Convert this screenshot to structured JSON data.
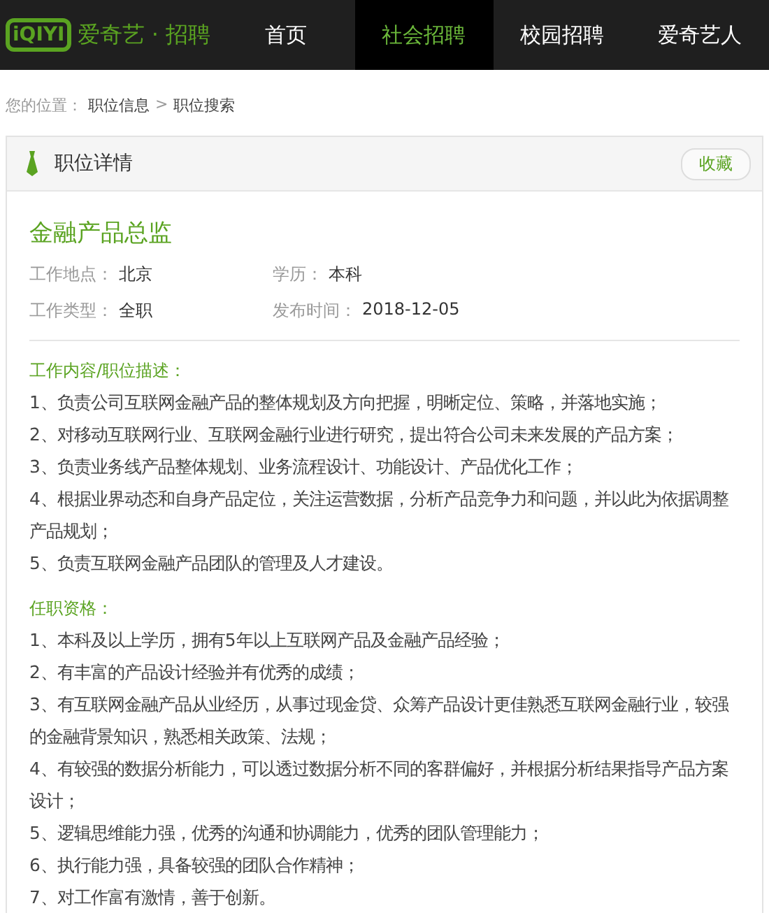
{
  "header": {
    "logo_mark": "iQIYI",
    "brand": "爱奇艺 · 招聘",
    "nav": [
      {
        "label": "首页",
        "selected": false
      },
      {
        "label": "社会招聘",
        "selected": true
      },
      {
        "label": "校园招聘",
        "selected": false
      },
      {
        "label": "爱奇艺人",
        "selected": false
      }
    ]
  },
  "breadcrumb": {
    "prefix": "您的位置：",
    "items": [
      "职位信息",
      "职位搜索"
    ],
    "separator": ">"
  },
  "panel": {
    "title": "职位详情",
    "favorite_button": "收藏"
  },
  "job": {
    "title": "金融产品总监",
    "fields": [
      {
        "label": "工作地点：",
        "value": "北京"
      },
      {
        "label": "学历：",
        "value": "本科"
      },
      {
        "label": "工作类型：",
        "value": "全职"
      },
      {
        "label": "发布时间：",
        "value": "2018-12-05"
      }
    ],
    "sections": [
      {
        "heading": "工作内容/职位描述：",
        "items": [
          "1、负责公司互联网金融产品的整体规划及方向把握，明晰定位、策略，并落地实施；",
          "2、对移动互联网行业、互联网金融行业进行研究，提出符合公司未来发展的产品方案；",
          "3、负责业务线产品整体规划、业务流程设计、功能设计、产品优化工作；",
          "4、根据业界动态和自身产品定位，关注运营数据，分析产品竞争力和问题，并以此为依据调整产品规划；",
          "5、负责互联网金融产品团队的管理及人才建设。"
        ]
      },
      {
        "heading": "任职资格：",
        "items": [
          "1、本科及以上学历，拥有5年以上互联网产品及金融产品经验；",
          "2、有丰富的产品设计经验并有优秀的成绩；",
          "3、有互联网金融产品从业经历，从事过现金贷、众筹产品设计更佳熟悉互联网金融行业，较强的金融背景知识，熟悉相关政策、法规；",
          "4、有较强的数据分析能力，可以透过数据分析不同的客群偏好，并根据分析结果指导产品方案设计；",
          "5、逻辑思维能力强，优秀的沟通和协调能力，优秀的团队管理能力；",
          "6、执行能力强，具备较强的团队合作精神；",
          "7、对工作富有激情，善于创新。"
        ]
      }
    ]
  }
}
